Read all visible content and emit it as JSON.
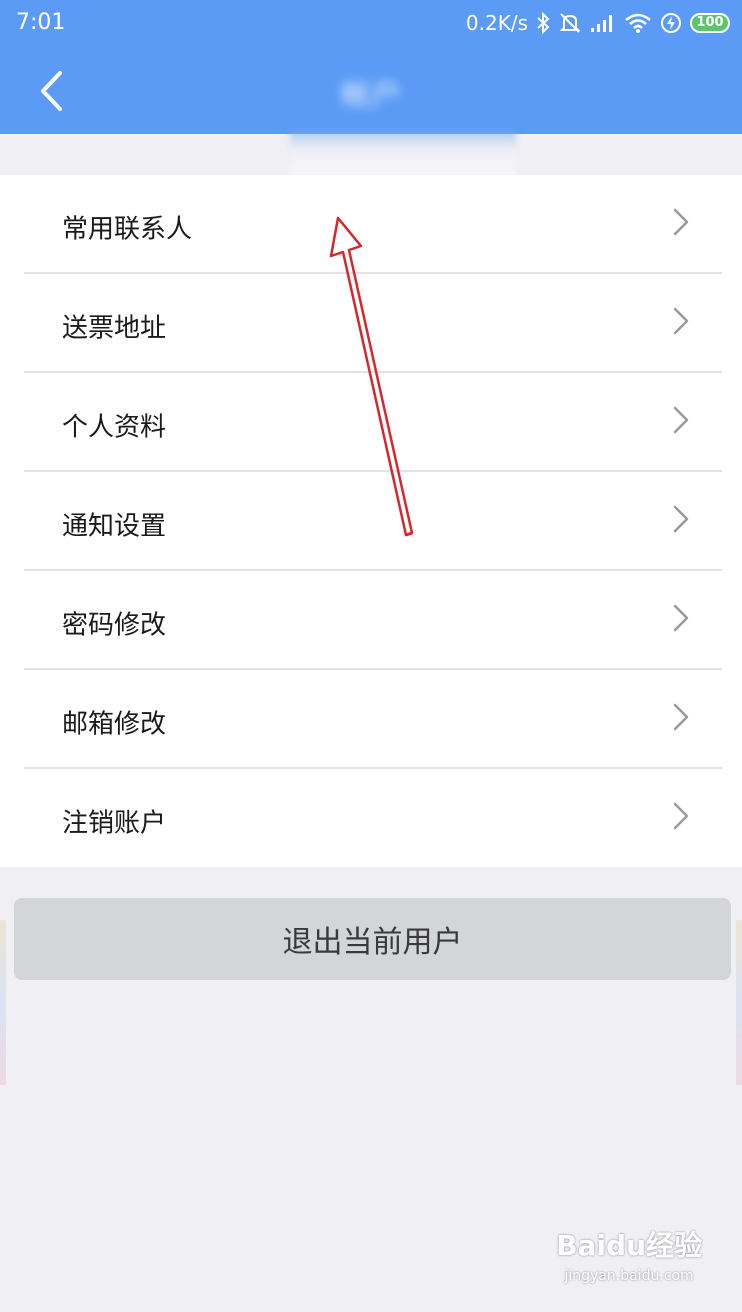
{
  "status_bar": {
    "time": "7:01",
    "net_speed": "0.2K/s",
    "battery": "100",
    "icons": [
      "bluetooth-icon",
      "mute-icon",
      "signal-icon",
      "wifi-icon",
      "charging-icon",
      "battery-icon"
    ]
  },
  "nav": {
    "back_icon": "chevron-left-icon",
    "title": "帐户"
  },
  "menu": {
    "items": [
      {
        "label": "常用联系人"
      },
      {
        "label": "送票地址"
      },
      {
        "label": "个人资料"
      },
      {
        "label": "通知设置"
      },
      {
        "label": "密码修改"
      },
      {
        "label": "邮箱修改"
      },
      {
        "label": "注销账户"
      }
    ],
    "item_icon": "chevron-right-icon"
  },
  "logout_button": "退出当前用户",
  "watermark": {
    "logo": "Baidu经验",
    "url": "jingyan.baidu.com"
  },
  "colors": {
    "primary": "#5b9bf5",
    "background": "#efeff4",
    "logout_button": "#d4d5d8",
    "annotation_arrow": "#d8262e",
    "battery": "#5cc46a"
  }
}
